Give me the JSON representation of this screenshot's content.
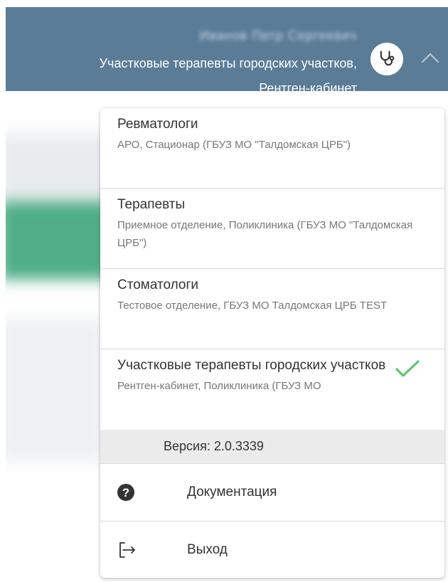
{
  "header": {
    "user_name": "Иванов Петр Сергеевич",
    "role_line": "Участковые терапевты городских участков,",
    "department_line": "Рентген-кабинет",
    "avatar_icon": "stethoscope-icon",
    "toggle_icon": "chevron-up-icon"
  },
  "roles": [
    {
      "title": "Ревматологи",
      "subtitle": "АРО, Стационар (ГБУЗ МО \"Талдомская ЦРБ\")",
      "selected": false
    },
    {
      "title": "Терапевты",
      "subtitle": "Приемное отделение, Поликлиника (ГБУЗ МО \"Талдомская ЦРБ\")",
      "selected": false
    },
    {
      "title": "Стоматологи",
      "subtitle": "Тестовое отделение, ГБУЗ МО Талдомская ЦРБ TEST",
      "selected": false
    },
    {
      "title": "Участковые терапевты городских участков",
      "subtitle": "Рентген-кабинет, Поликлиника (ГБУЗ МО",
      "selected": true
    }
  ],
  "version": "Версия: 2.0.3339",
  "menu": {
    "documentation_label": "Документация",
    "documentation_icon": "help-circle-icon",
    "logout_label": "Выход",
    "logout_icon": "logout-icon"
  },
  "colors": {
    "header_bg": "#5b7c96",
    "check_green": "#5cc46f",
    "version_bg": "#ebebeb"
  }
}
